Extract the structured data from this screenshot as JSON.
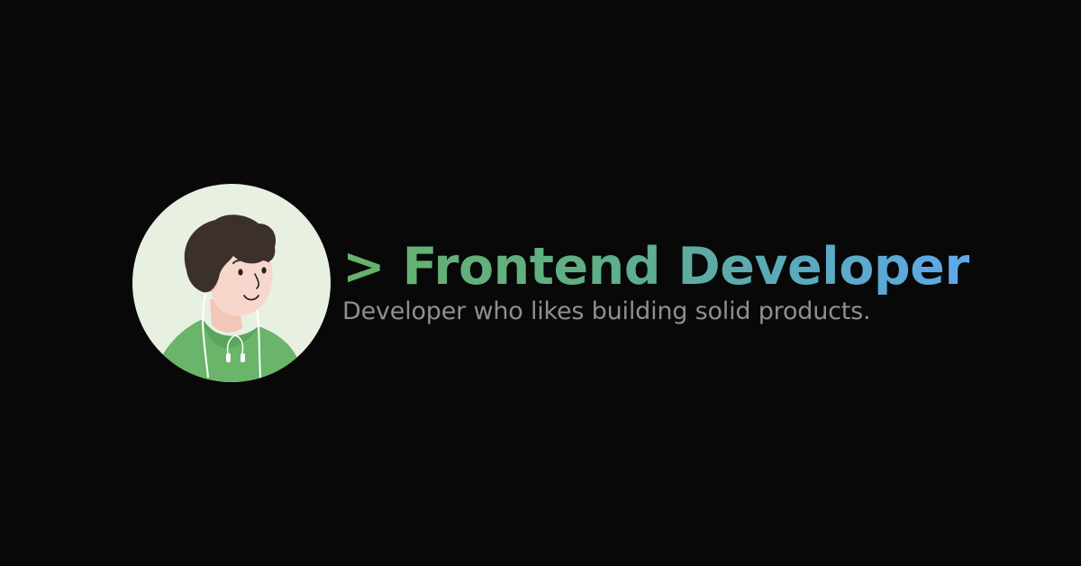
{
  "profile": {
    "headline": "> Frontend Developer",
    "tagline": "Developer who likes building solid products."
  },
  "avatar": {
    "icon": "developer-avatar-illustration"
  },
  "colors": {
    "background": "#080808",
    "avatar_bg": "#e8f0e2",
    "hoodie": "#6ab56a",
    "hair": "#3b302c",
    "skin": "#f7d7cb",
    "gradient_start": "#66b26c",
    "gradient_end": "#5ea8ec",
    "tagline": "#8f8f8f"
  }
}
